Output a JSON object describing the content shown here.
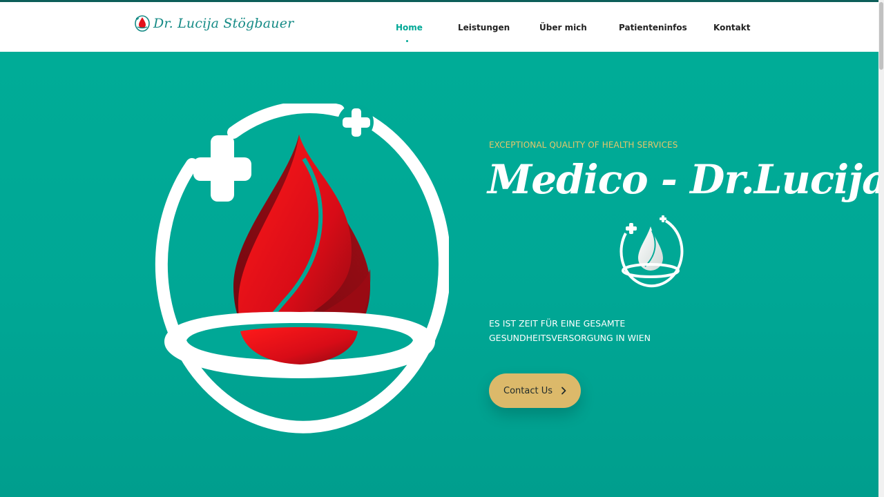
{
  "colors": {
    "accent": "#00a896",
    "brand_text": "#148a85",
    "eyebrow": "#e8c66a",
    "cta_bg": "#dcb96a",
    "drop_red": "#e3101a",
    "drop_dark": "#7d0b12"
  },
  "brand": {
    "name": "Dr. Lucija Stögbauer",
    "logo_icon": "blood-drop-logo-icon"
  },
  "nav": {
    "items": [
      {
        "label": "Home",
        "active": true
      },
      {
        "label": "Leistungen",
        "active": false
      },
      {
        "label": "Über mich",
        "active": false
      },
      {
        "label": "Patienteninfos",
        "active": false
      },
      {
        "label": "Kontakt",
        "active": false
      }
    ]
  },
  "hero": {
    "eyebrow": "EXCEPTIONAL QUALITY OF HEALTH SERVICES",
    "title": "Medico - Dr.Lucija",
    "subtitle": "ES IST ZEIT FÜR EINE GESAMTE GESUNDHEITSVERSORGUNG IN WIEN",
    "cta_label": "Contact Us",
    "cta_icon": "chevron-right-icon",
    "illustration_icon": "blood-drop-medical-emblem-icon",
    "small_logo_icon": "white-drop-emblem-icon"
  }
}
